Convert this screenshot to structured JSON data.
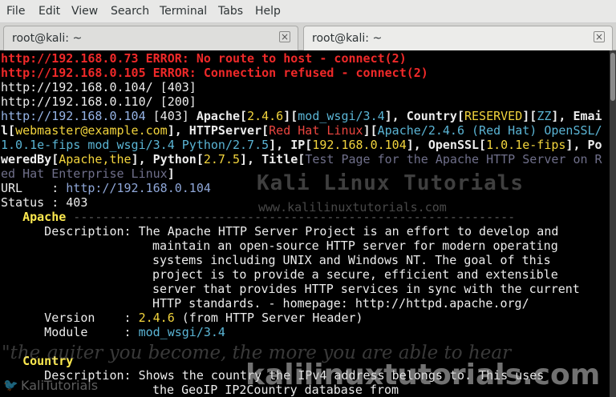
{
  "menubar": {
    "items": [
      "File",
      "Edit",
      "View",
      "Search",
      "Terminal",
      "Tabs",
      "Help"
    ]
  },
  "tabs": [
    {
      "title": "root@kali: ~",
      "close": "×"
    },
    {
      "title": "root@kali: ~",
      "close": "×"
    }
  ],
  "terminal": {
    "err1": "http://192.168.0.73 ERROR: No route to host - connect(2)",
    "err2": "http://192.168.0.105 ERROR: Connection refused - connect(2)",
    "l3": "http://192.168.0.104/ [403]",
    "l4": "http://192.168.0.110/ [200]",
    "l5": {
      "url": "http://192.168.0.104",
      "status": " [403] ",
      "apache_k": "Apache[",
      "apache_v": "2.4.6",
      "mid1": "][",
      "wsgi_v": "mod_wsgi/3.4",
      "mid2": "], ",
      "country_k": "Country[",
      "country_v": "RESERVED",
      "mid3": "][",
      "cc": "ZZ",
      "tail": "], Emai"
    },
    "l6": {
      "a": "l[",
      "email": "webmaster@example.com",
      "b": "], HTTPServer[",
      "os": "Red Hat Linux",
      "c": "][",
      "server": "Apache/2.4.6 (Red Hat) OpenSSL/"
    },
    "l7": {
      "server2": "1.0.1e-fips mod_wsgi/3.4 Python/2.7.5",
      "a": "], IP[",
      "ip": "192.168.0.104",
      "b": "], OpenSSL[",
      "ssl": "1.0.1e-fips",
      "c": "], Po"
    },
    "l8": {
      "a": "weredBy[",
      "pb": "Apache,the",
      "b": "], Python[",
      "py": "2.7.5",
      "c": "], Title[",
      "title": "Test Page for the Apache HTTP Server on R"
    },
    "l9": "ed Hat Enterprise Linux",
    "l9b": "]",
    "url_label": "URL    : ",
    "url_value": "http://192.168.0.104",
    "status_line": "Status : 403",
    "apache_heading": "Apache",
    "apache_dashes": " -------------------------------------------------------------",
    "desc_label": "      Description: ",
    "desc_lines": [
      "The Apache HTTP Server Project is an effort to develop and",
      "maintain an open-source HTTP server for modern operating",
      "systems including UNIX and Windows NT. The goal of this",
      "project is to provide a secure, efficient and extensible",
      "server that provides HTTP services in sync with the current",
      "HTTP standards. - homepage: http://httpd.apache.org/"
    ],
    "version_label": "      Version    : ",
    "version_value": "2.4.6",
    "version_note": " (from HTTP Server Header)",
    "module_label": "      Module     : ",
    "module_value": "mod_wsgi/3.4",
    "country_heading": "Country",
    "country_desc_label": "      Description: ",
    "country_desc_lines": [
      "Shows the country the IPv4 address belongs to. This uses",
      "the GeoIP IP2Country database from"
    ]
  },
  "watermarks": {
    "title": "Kali Linux Tutorials",
    "site": "www.kalilinuxtutorials.com",
    "quote": "\"the quiter you become, the more you are able to hear",
    "twitter": "KaliTutorials",
    "domain": "kalilinuxtutorials.com"
  },
  "colors": {
    "error": "#ef2929",
    "url_blue": "#96b4e6",
    "value_yellow": "#f2d43d",
    "heading_yellow": "#fce94f",
    "background": "#000000"
  }
}
